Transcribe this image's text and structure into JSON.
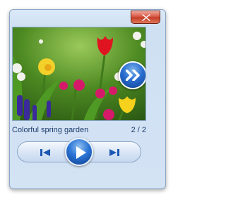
{
  "window": {
    "close_icon": "close-icon"
  },
  "photo": {
    "next_overlay_icon": "double-chevron-right-icon"
  },
  "caption": {
    "title": "Colorful spring garden",
    "counter": "2 / 2"
  },
  "controls": {
    "prev_icon": "skip-previous-icon",
    "play_icon": "play-icon",
    "next_icon": "skip-next-icon"
  },
  "colors": {
    "accent": "#2a6ed0",
    "close": "#c33d27",
    "caption_text": "#1d3c6e"
  }
}
